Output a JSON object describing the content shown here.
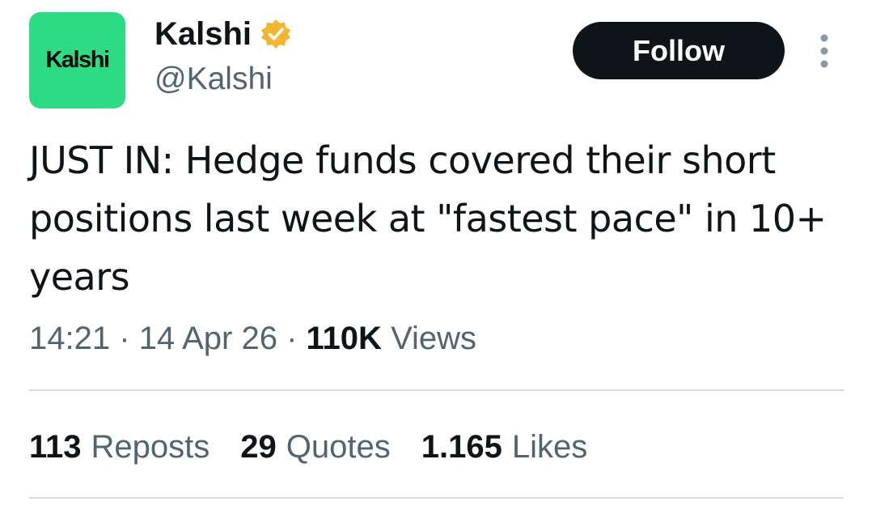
{
  "author": {
    "avatar_text": "Kalshi",
    "display_name": "Kalshi",
    "handle": "@Kalshi",
    "verified": true,
    "verified_badge_color": "#f2b632",
    "avatar_color": "#2ddb84"
  },
  "actions": {
    "follow_label": "Follow",
    "more_icon": "more-vertical-icon"
  },
  "tweet": {
    "text": "JUST IN: Hedge funds covered their short positions last week at \"fastest pace\" in 10+ years",
    "time": "14:21",
    "separator": "·",
    "date": "14 Apr 26",
    "views_count": "110K",
    "views_label": "Views"
  },
  "stats": {
    "reposts_count": "113",
    "reposts_label": "Reposts",
    "quotes_count": "29",
    "quotes_label": "Quotes",
    "likes_count": "1.165",
    "likes_label": "Likes"
  }
}
